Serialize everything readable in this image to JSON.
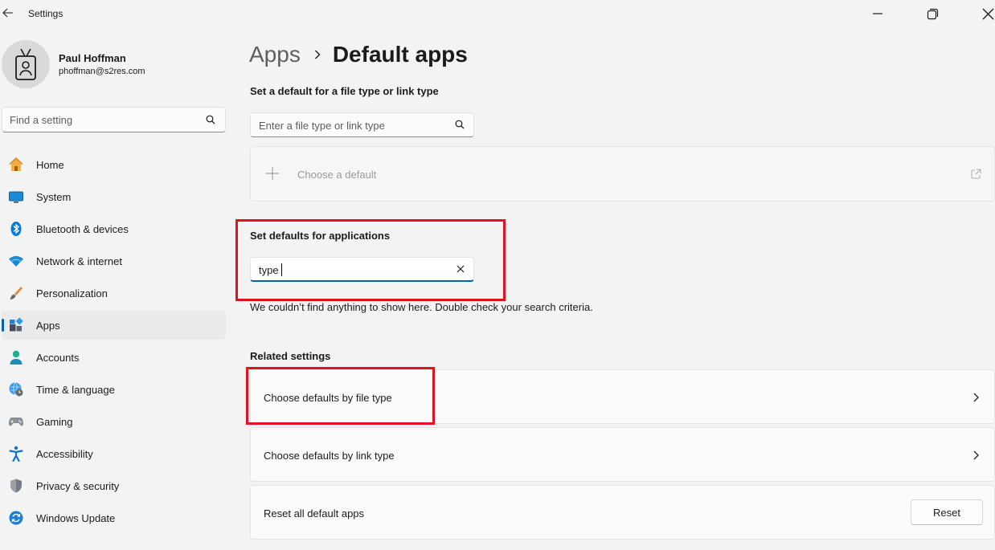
{
  "window": {
    "title": "Settings"
  },
  "profile": {
    "name": "Paul Hoffman",
    "email": "phoffman@s2res.com"
  },
  "sidebar": {
    "search_placeholder": "Find a setting",
    "items": [
      {
        "label": "Home",
        "icon": "home-icon"
      },
      {
        "label": "System",
        "icon": "system-icon"
      },
      {
        "label": "Bluetooth & devices",
        "icon": "bluetooth-icon"
      },
      {
        "label": "Network & internet",
        "icon": "wifi-icon"
      },
      {
        "label": "Personalization",
        "icon": "brush-icon"
      },
      {
        "label": "Apps",
        "icon": "apps-icon",
        "selected": true
      },
      {
        "label": "Accounts",
        "icon": "person-icon"
      },
      {
        "label": "Time & language",
        "icon": "globe-clock-icon"
      },
      {
        "label": "Gaming",
        "icon": "gamepad-icon"
      },
      {
        "label": "Accessibility",
        "icon": "accessibility-icon"
      },
      {
        "label": "Privacy & security",
        "icon": "shield-icon"
      },
      {
        "label": "Windows Update",
        "icon": "update-icon"
      }
    ]
  },
  "breadcrumb": {
    "parent": "Apps",
    "current": "Default apps"
  },
  "file_type_section": {
    "title": "Set a default for a file type or link type",
    "search_placeholder": "Enter a file type or link type",
    "choose_label": "Choose a default"
  },
  "apps_section": {
    "title": "Set defaults for applications",
    "search_value": "type",
    "empty_message": "We couldn’t find anything to show here. Double check your search criteria."
  },
  "related": {
    "title": "Related settings",
    "items": [
      {
        "label": "Choose defaults by file type"
      },
      {
        "label": "Choose defaults by link type"
      },
      {
        "label": "Reset all default apps",
        "button": "Reset"
      }
    ]
  },
  "colors": {
    "accent": "#005fb8",
    "highlight": "#e0141e",
    "background": "#f3f3f3"
  }
}
